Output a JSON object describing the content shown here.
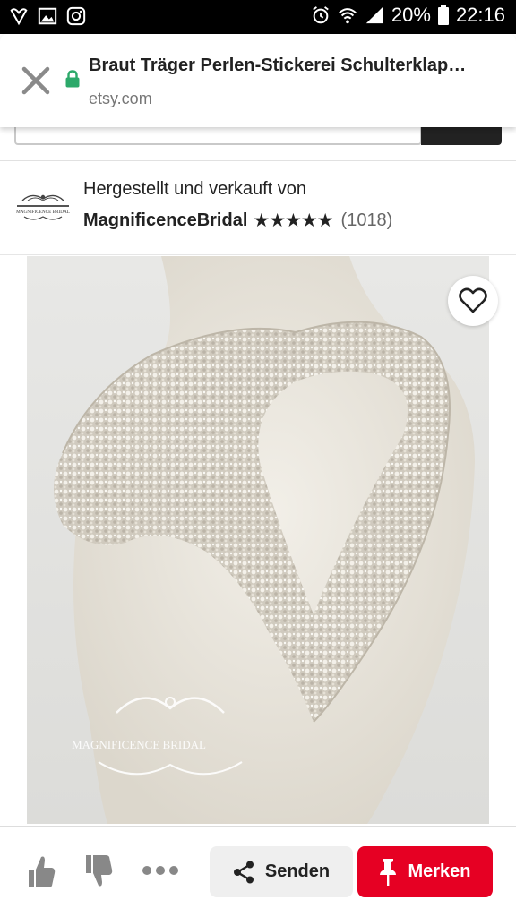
{
  "status_bar": {
    "battery_percent": "20%",
    "time": "22:16",
    "icons": [
      "heart-outline-icon",
      "gallery-icon",
      "instagram-icon",
      "alarm-icon",
      "wifi-icon",
      "signal-icon",
      "battery-icon"
    ]
  },
  "tab_header": {
    "title": "Braut Träger Perlen-Stickerei Schulterklap…",
    "url": "etsy.com",
    "icons": [
      "close-icon",
      "lock-icon"
    ],
    "lock_color": "#2ca96a"
  },
  "seller": {
    "made_by_text": "Hergestellt und verkauft von",
    "shop_name": "MagnificenceBridal",
    "rating_stars": "★★★★★",
    "rating_value": 5,
    "review_count": "(1018)",
    "logo_text": "MAGNIFICENCE BRIDAL"
  },
  "product_image": {
    "watermark_text": "MAGNIFICENCE BRIDAL",
    "icon": "heart-outline-icon"
  },
  "action_bar": {
    "icons": [
      "thumbs-up-icon",
      "thumbs-down-icon",
      "more-dots-icon",
      "share-icon",
      "pin-icon"
    ],
    "share_label": "Senden",
    "save_label": "Merken",
    "save_color": "#e60023"
  }
}
